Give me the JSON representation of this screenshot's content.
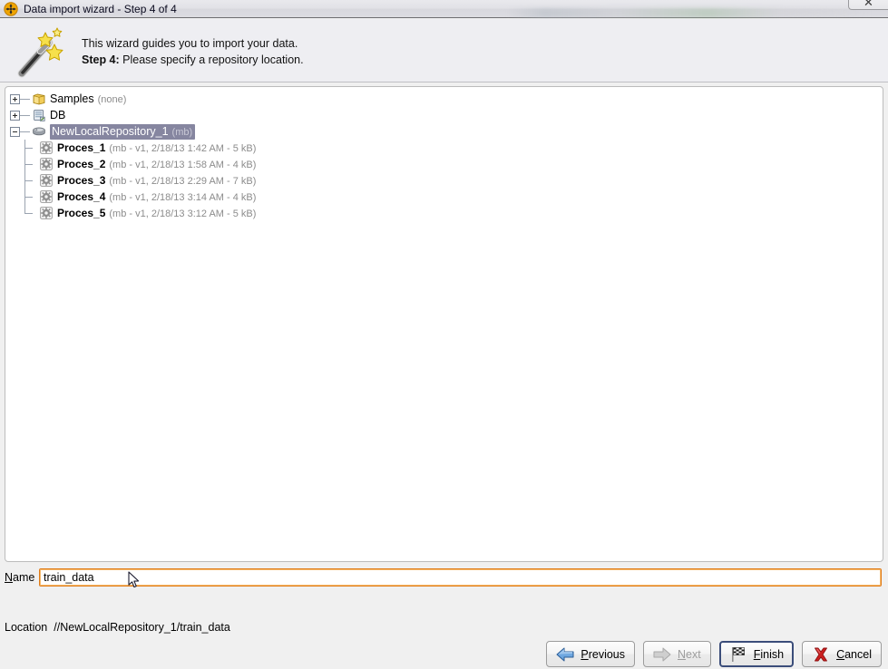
{
  "window": {
    "title": "Data import wizard - Step 4 of 4",
    "icon": "rapidminer-icon",
    "close_glyph": "✕"
  },
  "header": {
    "icon": "magic-wand-icon",
    "line1": "This wizard guides you to import your data.",
    "step_label": "Step 4:",
    "line2": " Please specify a repository location."
  },
  "tree": {
    "nodes": [
      {
        "label": "Samples",
        "meta": "(none)",
        "icon": "folder-icon",
        "expander": "plus",
        "level": 0,
        "selected": false
      },
      {
        "label": "DB",
        "meta": "",
        "icon": "database-icon",
        "expander": "plus",
        "level": 0,
        "selected": false
      },
      {
        "label": "NewLocalRepository_1",
        "meta": "(mb)",
        "icon": "repository-icon",
        "expander": "minus",
        "level": 0,
        "selected": true
      },
      {
        "label": "Proces_1",
        "meta": "(mb - v1, 2/18/13 1:42 AM - 5 kB)",
        "icon": "process-gear-icon",
        "expander": "none",
        "level": 1,
        "selected": false
      },
      {
        "label": "Proces_2",
        "meta": "(mb - v1, 2/18/13 1:58 AM - 4 kB)",
        "icon": "process-gear-icon",
        "expander": "none",
        "level": 1,
        "selected": false
      },
      {
        "label": "Proces_3",
        "meta": "(mb - v1, 2/18/13 2:29 AM - 7 kB)",
        "icon": "process-gear-icon",
        "expander": "none",
        "level": 1,
        "selected": false
      },
      {
        "label": "Proces_4",
        "meta": "(mb - v1, 2/18/13 3:14 AM - 4 kB)",
        "icon": "process-gear-icon",
        "expander": "none",
        "level": 1,
        "selected": false
      },
      {
        "label": "Proces_5",
        "meta": "(mb - v1, 2/18/13 3:12 AM - 5 kB)",
        "icon": "process-gear-icon",
        "expander": "none",
        "level": 1,
        "selected": false
      }
    ]
  },
  "name_field": {
    "label_mnemonic": "N",
    "label_rest": "ame",
    "value": "train_data",
    "placeholder": ""
  },
  "location": {
    "label": "Location",
    "value": "//NewLocalRepository_1/train_data"
  },
  "buttons": {
    "previous": {
      "mnemonic": "P",
      "rest": "revious",
      "icon": "arrow-left-icon",
      "state": "enabled"
    },
    "next": {
      "mnemonic": "N",
      "rest": "ext",
      "icon": "arrow-right-icon",
      "state": "disabled"
    },
    "finish": {
      "mnemonic": "F",
      "rest": "inish",
      "icon": "checkered-flag-icon",
      "state": "focused"
    },
    "cancel": {
      "mnemonic": "C",
      "rest": "ancel",
      "icon": "red-x-icon",
      "state": "enabled"
    }
  },
  "colors": {
    "selection": "#8686a0",
    "input_focus_border": "#e07b18",
    "focus_button_border": "#3b4d7a",
    "header_bg": "#eeeef2",
    "panel_bg": "#ffffff"
  }
}
